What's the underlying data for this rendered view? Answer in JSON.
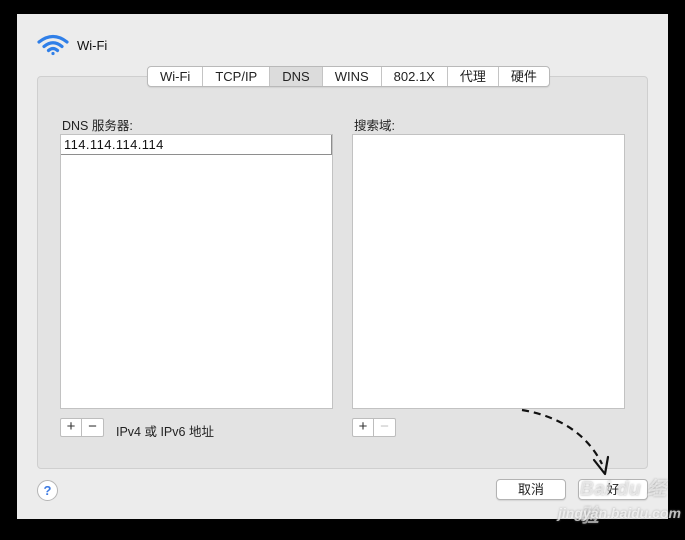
{
  "window": {
    "title": "Wi-Fi",
    "title_icon": "wifi-icon"
  },
  "tabs": [
    {
      "label": "Wi-Fi",
      "active": false
    },
    {
      "label": "TCP/IP",
      "active": false
    },
    {
      "label": "DNS",
      "active": true
    },
    {
      "label": "WINS",
      "active": false
    },
    {
      "label": "802.1X",
      "active": false
    },
    {
      "label": "代理",
      "active": false
    },
    {
      "label": "硬件",
      "active": false
    }
  ],
  "dns_servers": {
    "label": "DNS 服务器:",
    "entries": [
      "114.114.114.114"
    ],
    "add_label": "+",
    "remove_label": "−",
    "address_note": "IPv4 或 IPv6 地址"
  },
  "search_domains": {
    "label": "搜索域:",
    "entries": [],
    "add_label": "+",
    "remove_label": "−"
  },
  "footer": {
    "help_label": "?",
    "cancel_label": "取消",
    "ok_label": "好"
  },
  "watermark": {
    "main": "Bai du 经验",
    "sub": "jingyan.baidu.com"
  }
}
